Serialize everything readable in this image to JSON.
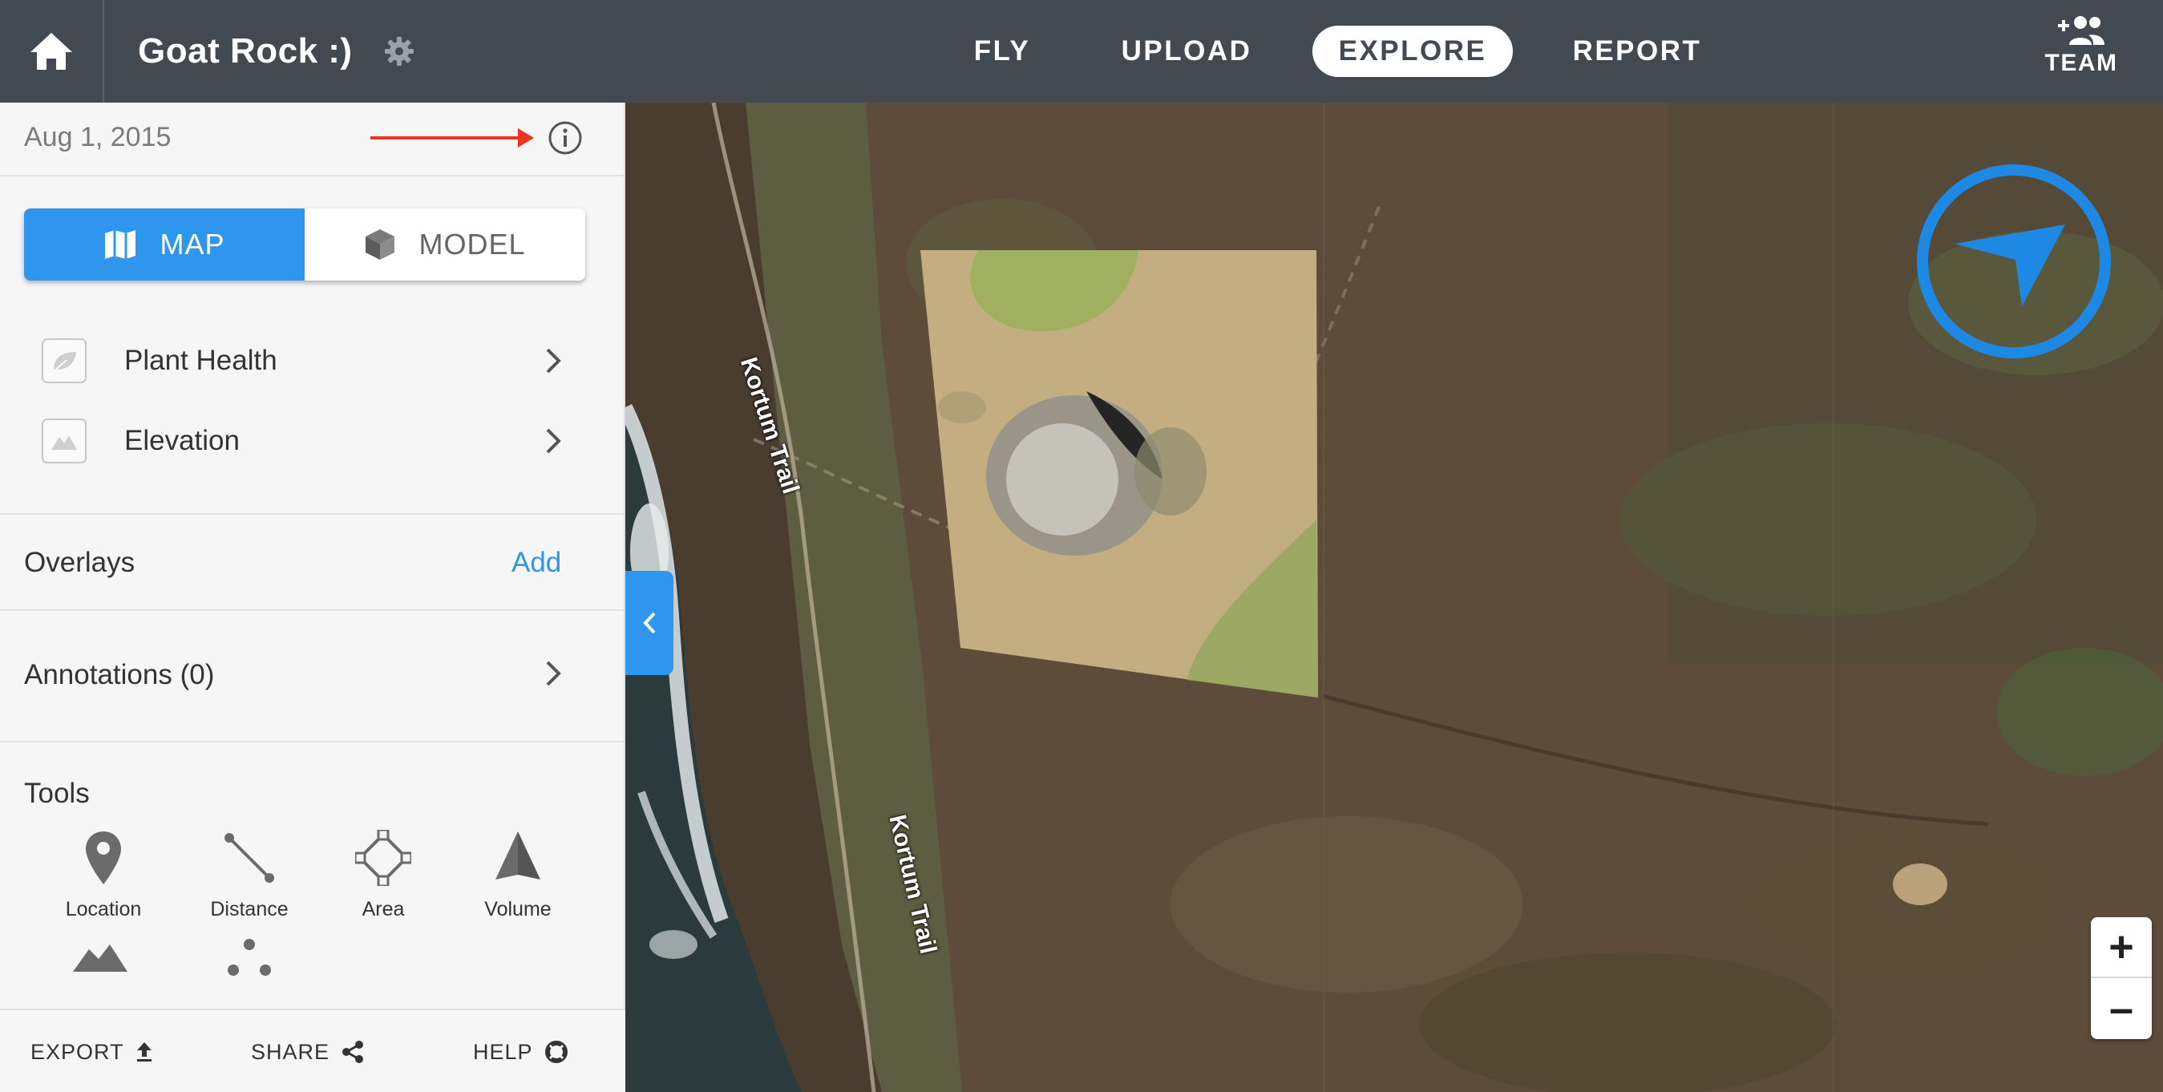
{
  "header": {
    "project_title": "Goat Rock :)",
    "nav": [
      {
        "label": "FLY",
        "active": false
      },
      {
        "label": "UPLOAD",
        "active": false
      },
      {
        "label": "EXPLORE",
        "active": true
      },
      {
        "label": "REPORT",
        "active": false
      }
    ],
    "team_label": "TEAM"
  },
  "sidebar": {
    "date": "Aug 1, 2015",
    "view_toggle": {
      "map_label": "MAP",
      "model_label": "MODEL",
      "selected": "MAP"
    },
    "layers": [
      {
        "label": "Plant Health",
        "icon": "leaf-icon"
      },
      {
        "label": "Elevation",
        "icon": "mountain-icon"
      }
    ],
    "overlays": {
      "label": "Overlays",
      "action": "Add"
    },
    "annotations": {
      "label": "Annotations (0)"
    },
    "tools": {
      "label": "Tools",
      "items": [
        {
          "label": "Location",
          "icon": "pin-icon"
        },
        {
          "label": "Distance",
          "icon": "ruler-line-icon"
        },
        {
          "label": "Area",
          "icon": "polygon-icon"
        },
        {
          "label": "Volume",
          "icon": "pyramid-icon"
        },
        {
          "label": "",
          "icon": "terrain-icon"
        },
        {
          "label": "",
          "icon": "points-icon"
        }
      ]
    },
    "footer": {
      "export": "EXPORT",
      "share": "SHARE",
      "help": "HELP"
    }
  },
  "map": {
    "trail_labels": [
      "Kortum Trail",
      "Kortum Trail"
    ],
    "zoom_in": "+",
    "zoom_out": "–"
  },
  "colors": {
    "topbar": "#424950",
    "accent": "#2f96ee",
    "annotation_arrow": "#ee3322",
    "sidebar_bg": "#f6f6f6"
  }
}
